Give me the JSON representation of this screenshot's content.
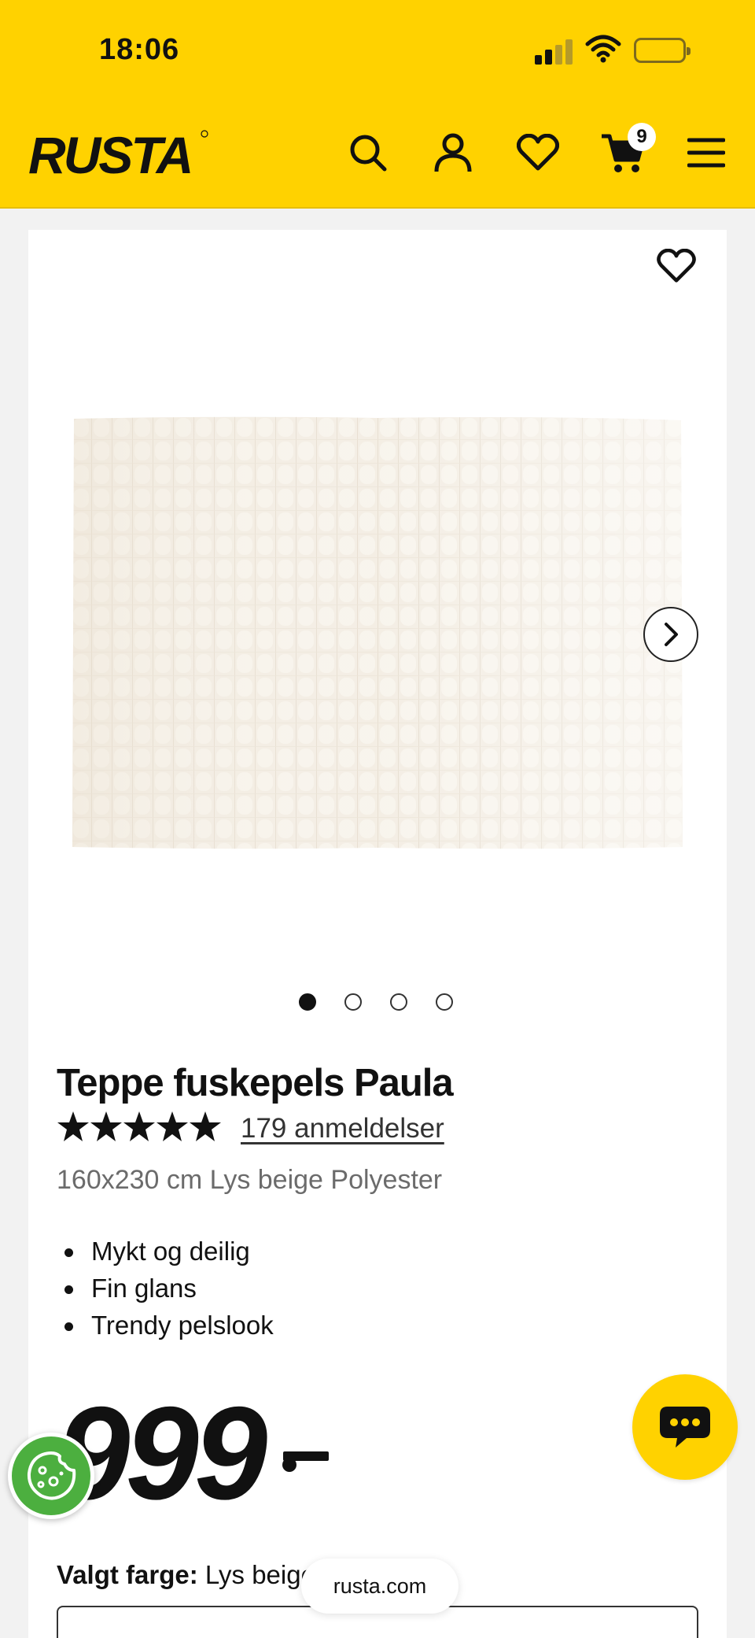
{
  "status_bar": {
    "time": "18:06"
  },
  "header": {
    "brand": "RUSTA",
    "cart_count": "9"
  },
  "product": {
    "title": "Teppe fuskepels Paula",
    "rating_stars": 5,
    "reviews": "179 anmeldelser",
    "subtitle": "160x230 cm Lys beige Polyester",
    "bullets": [
      "Mykt og deilig",
      "Fin glans",
      "Trendy pelslook"
    ],
    "price": "999",
    "color_label": "Valgt farge:",
    "color_value": "Lys beige"
  },
  "gallery": {
    "image_count": 4,
    "active_index": 0
  },
  "browser": {
    "url": "rusta.com"
  },
  "colors": {
    "brand_yellow": "#ffd200",
    "cookie_green": "#4caf3f"
  }
}
